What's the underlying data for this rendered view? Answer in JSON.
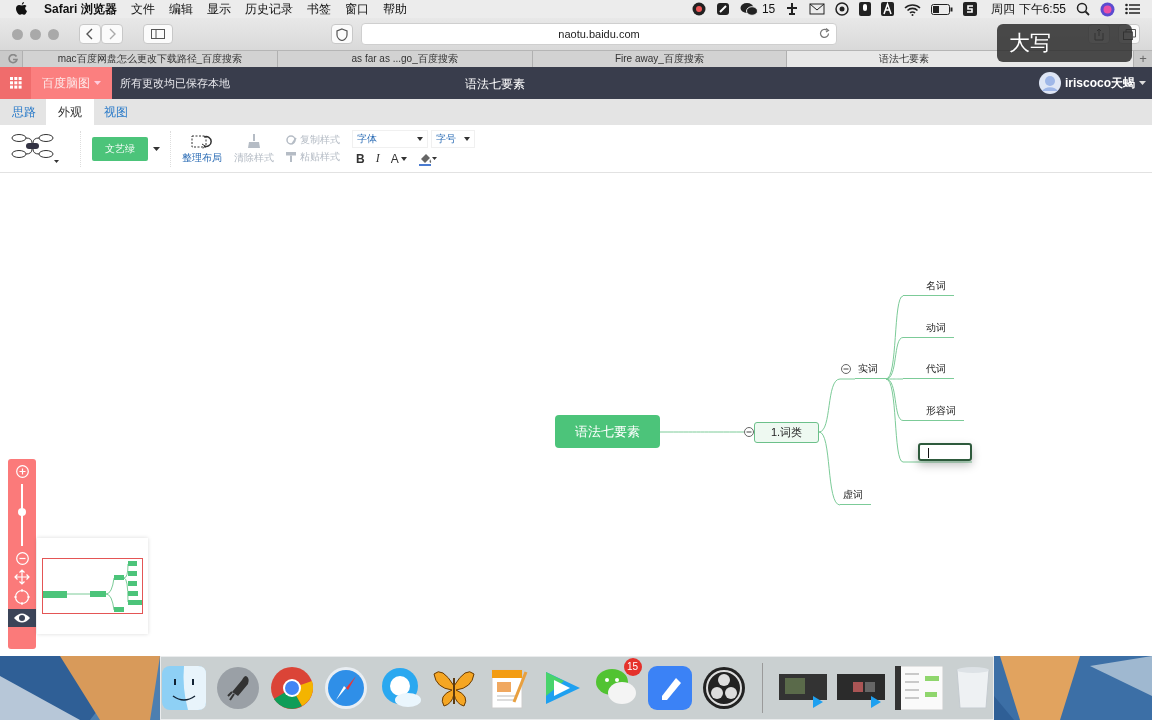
{
  "menu_bar": {
    "app_name": "Safari 浏览器",
    "menus": [
      "文件",
      "编辑",
      "显示",
      "历史记录",
      "书签",
      "窗口",
      "帮助"
    ],
    "wechat_count": "15",
    "clock": "周四 下午6:55"
  },
  "browser": {
    "url": "naotu.baidu.com",
    "tabs": [
      {
        "title": "mac百度网盘怎么更改下载路径_百度搜索",
        "selected": false
      },
      {
        "title": "as far as ...go_百度搜索",
        "selected": false
      },
      {
        "title": "Fire away_百度搜索",
        "selected": false
      },
      {
        "title": "语法七要素",
        "selected": true
      }
    ],
    "new_tab": "+"
  },
  "caps_lock_hud": "大写",
  "app_header": {
    "brand": "百度脑图",
    "save_status": "所有更改均已保存本地",
    "document_title": "语法七要素",
    "user_name": "iriscoco天蝎"
  },
  "ribbon_tabs": [
    {
      "label": "思路",
      "selected": false
    },
    {
      "label": "外观",
      "selected": true
    },
    {
      "label": "视图",
      "selected": false
    }
  ],
  "toolbar": {
    "theme": "文艺绿",
    "arrange_layout": "整理布局",
    "clear_style": {
      "label": "清除样式",
      "disabled": true
    },
    "copy_style": {
      "label": "复制样式",
      "disabled": true
    },
    "paste_style": {
      "label": "粘贴样式",
      "disabled": true
    },
    "font_family": "字体",
    "font_size": "字号",
    "bold": "B",
    "italic": "I",
    "font_color": "A"
  },
  "mindmap": {
    "root": {
      "text": "语法七要素",
      "children": [
        {
          "text": "1.词类",
          "expanded": true,
          "children": [
            {
              "text": "实词",
              "expanded": true,
              "children": [
                {
                  "kind": "topic",
                  "text": "名词"
                },
                {
                  "kind": "topic",
                  "text": "动词"
                },
                {
                  "kind": "topic",
                  "text": "代词"
                },
                {
                  "kind": "topic",
                  "text": "形容词"
                },
                {
                  "kind": "editing"
                }
              ]
            },
            {
              "text": "虚词"
            }
          ]
        }
      ]
    }
  },
  "navigator": {
    "zoom_slider": {
      "level": 0.55
    },
    "minimap_visible": true
  },
  "dock": {
    "wechat_badge": "15"
  }
}
